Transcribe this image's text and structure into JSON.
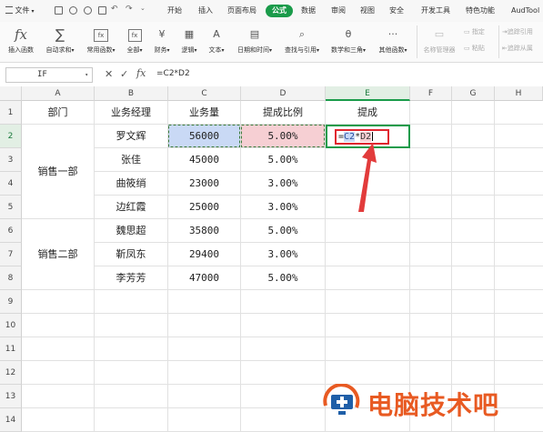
{
  "menu": {
    "file": "文件",
    "tabs": [
      "开始",
      "插入",
      "页面布局",
      "公式",
      "数据",
      "审阅",
      "视图",
      "安全",
      "开发工具",
      "特色功能",
      "AudTool"
    ],
    "active_tab": "公式"
  },
  "ribbon": {
    "insert_func": "插入函数",
    "auto_sum": "自动求和",
    "common_func": "常用函数",
    "all": "全部",
    "finance": "财务",
    "logic": "逻辑",
    "text": "文本",
    "datetime": "日期和时间",
    "lookup": "查找与引用",
    "math": "数学和三角",
    "other": "其他函数",
    "name_manager": "名称管理器",
    "specify": "指定",
    "paste": "粘贴",
    "trace_precedents": "追踪引用",
    "trace_dependents": "追踪从属"
  },
  "formula_bar": {
    "name_box": "IF",
    "formula": "=C2*D2",
    "fx_label": "fx"
  },
  "grid": {
    "col_headers": [
      "A",
      "B",
      "C",
      "D",
      "E",
      "F",
      "G",
      "H"
    ],
    "row_headers": [
      "1",
      "2",
      "3",
      "4",
      "5",
      "6",
      "7",
      "8",
      "9",
      "10",
      "11",
      "12",
      "13",
      "14"
    ],
    "headers": [
      "部门",
      "业务经理",
      "业务量",
      "提成比例",
      "提成"
    ],
    "groups": [
      "销售一部",
      "销售二部"
    ],
    "rows": [
      {
        "manager": "罗文辉",
        "volume": "56000",
        "rate": "5.00%"
      },
      {
        "manager": "张佳",
        "volume": "45000",
        "rate": "5.00%"
      },
      {
        "manager": "曲筱绡",
        "volume": "23000",
        "rate": "3.00%"
      },
      {
        "manager": "边红霞",
        "volume": "25000",
        "rate": "3.00%"
      },
      {
        "manager": "魏思超",
        "volume": "35800",
        "rate": "5.00%"
      },
      {
        "manager": "靳凤东",
        "volume": "29400",
        "rate": "3.00%"
      },
      {
        "manager": "李芳芳",
        "volume": "47000",
        "rate": "5.00%"
      }
    ],
    "editing": {
      "eq": "=",
      "ref1": "C2",
      "op": "*",
      "ref2": "D2"
    }
  },
  "watermark": {
    "text": "电脑技术吧"
  },
  "colors": {
    "accent": "#1a9b4a",
    "arrow": "#e23b3b",
    "ref_blue": "#c9d9f5",
    "ref_red": "#f6cfd3"
  }
}
